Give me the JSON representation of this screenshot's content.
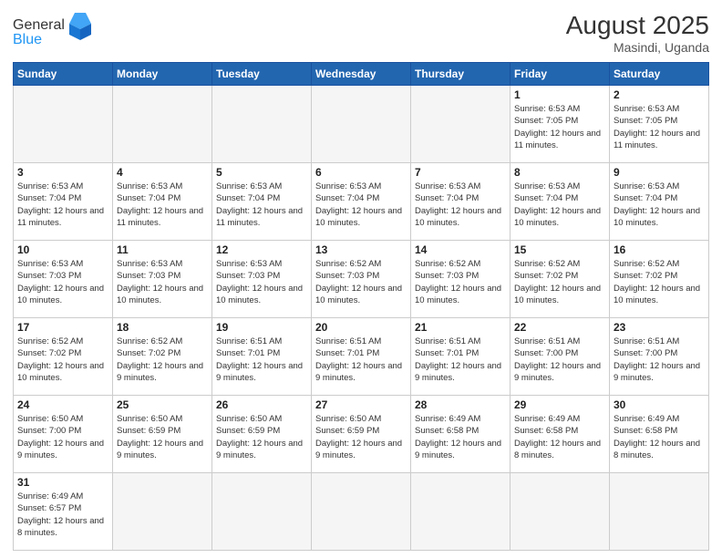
{
  "header": {
    "logo_general": "General",
    "logo_blue": "Blue",
    "month_year": "August 2025",
    "location": "Masindi, Uganda"
  },
  "days_of_week": [
    "Sunday",
    "Monday",
    "Tuesday",
    "Wednesday",
    "Thursday",
    "Friday",
    "Saturday"
  ],
  "weeks": [
    [
      {
        "day": "",
        "info": "",
        "empty": true
      },
      {
        "day": "",
        "info": "",
        "empty": true
      },
      {
        "day": "",
        "info": "",
        "empty": true
      },
      {
        "day": "",
        "info": "",
        "empty": true
      },
      {
        "day": "",
        "info": "",
        "empty": true
      },
      {
        "day": "1",
        "info": "Sunrise: 6:53 AM\nSunset: 7:05 PM\nDaylight: 12 hours and 11 minutes."
      },
      {
        "day": "2",
        "info": "Sunrise: 6:53 AM\nSunset: 7:05 PM\nDaylight: 12 hours and 11 minutes."
      }
    ],
    [
      {
        "day": "3",
        "info": "Sunrise: 6:53 AM\nSunset: 7:04 PM\nDaylight: 12 hours and 11 minutes."
      },
      {
        "day": "4",
        "info": "Sunrise: 6:53 AM\nSunset: 7:04 PM\nDaylight: 12 hours and 11 minutes."
      },
      {
        "day": "5",
        "info": "Sunrise: 6:53 AM\nSunset: 7:04 PM\nDaylight: 12 hours and 11 minutes."
      },
      {
        "day": "6",
        "info": "Sunrise: 6:53 AM\nSunset: 7:04 PM\nDaylight: 12 hours and 10 minutes."
      },
      {
        "day": "7",
        "info": "Sunrise: 6:53 AM\nSunset: 7:04 PM\nDaylight: 12 hours and 10 minutes."
      },
      {
        "day": "8",
        "info": "Sunrise: 6:53 AM\nSunset: 7:04 PM\nDaylight: 12 hours and 10 minutes."
      },
      {
        "day": "9",
        "info": "Sunrise: 6:53 AM\nSunset: 7:04 PM\nDaylight: 12 hours and 10 minutes."
      }
    ],
    [
      {
        "day": "10",
        "info": "Sunrise: 6:53 AM\nSunset: 7:03 PM\nDaylight: 12 hours and 10 minutes."
      },
      {
        "day": "11",
        "info": "Sunrise: 6:53 AM\nSunset: 7:03 PM\nDaylight: 12 hours and 10 minutes."
      },
      {
        "day": "12",
        "info": "Sunrise: 6:53 AM\nSunset: 7:03 PM\nDaylight: 12 hours and 10 minutes."
      },
      {
        "day": "13",
        "info": "Sunrise: 6:52 AM\nSunset: 7:03 PM\nDaylight: 12 hours and 10 minutes."
      },
      {
        "day": "14",
        "info": "Sunrise: 6:52 AM\nSunset: 7:03 PM\nDaylight: 12 hours and 10 minutes."
      },
      {
        "day": "15",
        "info": "Sunrise: 6:52 AM\nSunset: 7:02 PM\nDaylight: 12 hours and 10 minutes."
      },
      {
        "day": "16",
        "info": "Sunrise: 6:52 AM\nSunset: 7:02 PM\nDaylight: 12 hours and 10 minutes."
      }
    ],
    [
      {
        "day": "17",
        "info": "Sunrise: 6:52 AM\nSunset: 7:02 PM\nDaylight: 12 hours and 10 minutes."
      },
      {
        "day": "18",
        "info": "Sunrise: 6:52 AM\nSunset: 7:02 PM\nDaylight: 12 hours and 9 minutes."
      },
      {
        "day": "19",
        "info": "Sunrise: 6:51 AM\nSunset: 7:01 PM\nDaylight: 12 hours and 9 minutes."
      },
      {
        "day": "20",
        "info": "Sunrise: 6:51 AM\nSunset: 7:01 PM\nDaylight: 12 hours and 9 minutes."
      },
      {
        "day": "21",
        "info": "Sunrise: 6:51 AM\nSunset: 7:01 PM\nDaylight: 12 hours and 9 minutes."
      },
      {
        "day": "22",
        "info": "Sunrise: 6:51 AM\nSunset: 7:00 PM\nDaylight: 12 hours and 9 minutes."
      },
      {
        "day": "23",
        "info": "Sunrise: 6:51 AM\nSunset: 7:00 PM\nDaylight: 12 hours and 9 minutes."
      }
    ],
    [
      {
        "day": "24",
        "info": "Sunrise: 6:50 AM\nSunset: 7:00 PM\nDaylight: 12 hours and 9 minutes."
      },
      {
        "day": "25",
        "info": "Sunrise: 6:50 AM\nSunset: 6:59 PM\nDaylight: 12 hours and 9 minutes."
      },
      {
        "day": "26",
        "info": "Sunrise: 6:50 AM\nSunset: 6:59 PM\nDaylight: 12 hours and 9 minutes."
      },
      {
        "day": "27",
        "info": "Sunrise: 6:50 AM\nSunset: 6:59 PM\nDaylight: 12 hours and 9 minutes."
      },
      {
        "day": "28",
        "info": "Sunrise: 6:49 AM\nSunset: 6:58 PM\nDaylight: 12 hours and 9 minutes."
      },
      {
        "day": "29",
        "info": "Sunrise: 6:49 AM\nSunset: 6:58 PM\nDaylight: 12 hours and 8 minutes."
      },
      {
        "day": "30",
        "info": "Sunrise: 6:49 AM\nSunset: 6:58 PM\nDaylight: 12 hours and 8 minutes."
      }
    ],
    [
      {
        "day": "31",
        "info": "Sunrise: 6:49 AM\nSunset: 6:57 PM\nDaylight: 12 hours and 8 minutes."
      },
      {
        "day": "",
        "info": "",
        "empty": true
      },
      {
        "day": "",
        "info": "",
        "empty": true
      },
      {
        "day": "",
        "info": "",
        "empty": true
      },
      {
        "day": "",
        "info": "",
        "empty": true
      },
      {
        "day": "",
        "info": "",
        "empty": true
      },
      {
        "day": "",
        "info": "",
        "empty": true
      }
    ]
  ]
}
